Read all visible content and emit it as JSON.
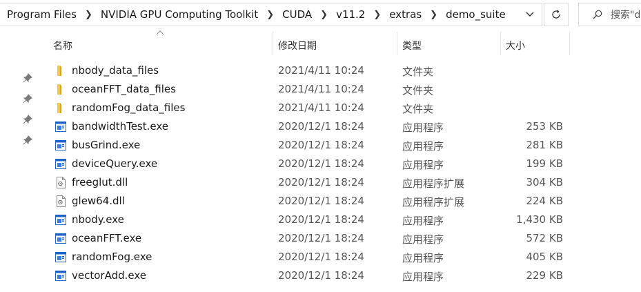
{
  "breadcrumb": [
    "Program Files",
    "NVIDIA GPU Computing Toolkit",
    "CUDA",
    "v11.2",
    "extras",
    "demo_suite"
  ],
  "search": {
    "placeholder": "搜索\"d"
  },
  "columns": {
    "name": "名称",
    "date": "修改日期",
    "type": "类型",
    "size": "大小"
  },
  "colors": {
    "folder": "#e8b838",
    "exe": "#1e64c8",
    "border": "#d9d9d9"
  },
  "files": [
    {
      "name": "nbody_data_files",
      "date": "2021/4/11 10:24",
      "type": "文件夹",
      "size": "",
      "icon": "folder-icon"
    },
    {
      "name": "oceanFFT_data_files",
      "date": "2021/4/11 10:24",
      "type": "文件夹",
      "size": "",
      "icon": "folder-icon"
    },
    {
      "name": "randomFog_data_files",
      "date": "2021/4/11 10:24",
      "type": "文件夹",
      "size": "",
      "icon": "folder-icon"
    },
    {
      "name": "bandwidthTest.exe",
      "date": "2020/12/1 18:24",
      "type": "应用程序",
      "size": "253 KB",
      "icon": "exe-icon"
    },
    {
      "name": "busGrind.exe",
      "date": "2020/12/1 18:24",
      "type": "应用程序",
      "size": "281 KB",
      "icon": "exe-icon"
    },
    {
      "name": "deviceQuery.exe",
      "date": "2020/12/1 18:24",
      "type": "应用程序",
      "size": "199 KB",
      "icon": "exe-icon"
    },
    {
      "name": "freeglut.dll",
      "date": "2020/12/1 18:24",
      "type": "应用程序扩展",
      "size": "304 KB",
      "icon": "dll-icon"
    },
    {
      "name": "glew64.dll",
      "date": "2020/12/1 18:24",
      "type": "应用程序扩展",
      "size": "224 KB",
      "icon": "dll-icon"
    },
    {
      "name": "nbody.exe",
      "date": "2020/12/1 18:24",
      "type": "应用程序",
      "size": "1,430 KB",
      "icon": "exe-icon"
    },
    {
      "name": "oceanFFT.exe",
      "date": "2020/12/1 18:24",
      "type": "应用程序",
      "size": "572 KB",
      "icon": "exe-icon"
    },
    {
      "name": "randomFog.exe",
      "date": "2020/12/1 18:24",
      "type": "应用程序",
      "size": "405 KB",
      "icon": "exe-icon"
    },
    {
      "name": "vectorAdd.exe",
      "date": "2020/12/1 18:24",
      "type": "应用程序",
      "size": "229 KB",
      "icon": "exe-icon"
    }
  ]
}
